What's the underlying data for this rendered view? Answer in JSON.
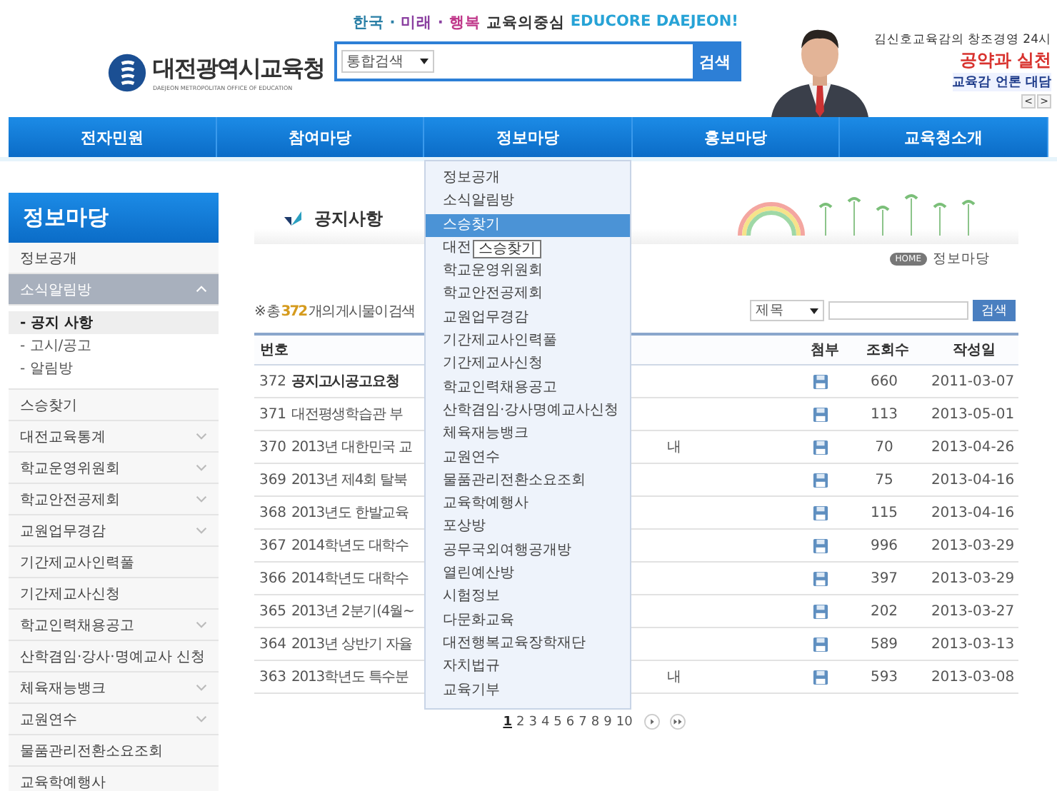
{
  "header": {
    "logo": {
      "title": "대전광역시교육청",
      "subtitle": "DAEJEON METROPOLITAN OFFICE OF EDUCATION"
    },
    "slogan": [
      {
        "text": "한국 ·",
        "color": "#2a7fa6"
      },
      {
        "text": "미래 ·",
        "color": "#8a3fa0"
      },
      {
        "text": "행복",
        "color": "#c0388a"
      },
      {
        "text": "교육의중심",
        "color": "#333333"
      },
      {
        "text": "EDUCORE DAEJEON!",
        "color": "#27a3d6"
      }
    ],
    "search": {
      "scope": "통합검색",
      "button": "검색"
    },
    "promo": {
      "line1": "김신호교육감의 창조경영 24시",
      "line2": "공약과 실천",
      "line3": "교육감 언론 대담",
      "prev": "<",
      "next": ">"
    }
  },
  "nav": [
    "전자민원",
    "참여마당",
    "정보마당",
    "홍보마당",
    "교육청소개"
  ],
  "sidebar": {
    "title": "정보마당",
    "items": [
      {
        "label": "정보공개",
        "kind": "link",
        "selected": false
      },
      {
        "label": "소식알림방",
        "kind": "folder",
        "expanded": true,
        "selected": true,
        "children": [
          {
            "label": "- 공지 사항",
            "selected": true
          },
          {
            "label": "- 고시/공고",
            "selected": false
          },
          {
            "label": "- 알림방",
            "selected": false
          }
        ]
      },
      {
        "label": "스승찾기",
        "kind": "link",
        "selected": false
      },
      {
        "label": "대전교육통계",
        "kind": "folder",
        "expanded": false,
        "selected": false
      },
      {
        "label": "학교운영위원회",
        "kind": "folder",
        "expanded": false,
        "selected": false
      },
      {
        "label": "학교안전공제회",
        "kind": "folder",
        "expanded": false,
        "selected": false
      },
      {
        "label": "교원업무경감",
        "kind": "folder",
        "expanded": false,
        "selected": false
      },
      {
        "label": "기간제교사인력풀",
        "kind": "link",
        "selected": false
      },
      {
        "label": "기간제교사신청",
        "kind": "link",
        "selected": false
      },
      {
        "label": "학교인력채용공고",
        "kind": "folder",
        "expanded": false,
        "selected": false
      },
      {
        "label": "산학겸임·강사·명예교사 신청",
        "kind": "link",
        "selected": false
      },
      {
        "label": "체육재능뱅크",
        "kind": "folder",
        "expanded": false,
        "selected": false
      },
      {
        "label": "교원연수",
        "kind": "folder",
        "expanded": false,
        "selected": false
      },
      {
        "label": "물품관리전환소요조회",
        "kind": "link",
        "selected": false
      },
      {
        "label": "교육학예행사",
        "kind": "link",
        "selected": false
      }
    ]
  },
  "content": {
    "title": "공지사항",
    "breadcrumb": {
      "home": "HOME",
      "current": "정보마당"
    },
    "count": {
      "prefix": "※ 총",
      "number": "372",
      "suffix": "개의 게시물이 검색"
    },
    "search": {
      "field": "제목",
      "button": "검색"
    },
    "table": {
      "columns": [
        "번호",
        "첨부",
        "조회수",
        "작성일"
      ],
      "rows": [
        {
          "no": "372",
          "title": "공지고시공고요청",
          "bold": true,
          "views": "660",
          "date": "2011-03-07"
        },
        {
          "no": "371",
          "title": "대전평생학습관 부",
          "bold": false,
          "views": "113",
          "date": "2013-05-01"
        },
        {
          "no": "370",
          "title": "2013년 대한민국 교",
          "title_end": "내",
          "bold": false,
          "views": "70",
          "date": "2013-04-26"
        },
        {
          "no": "369",
          "title": "2013년 제4회 탈북",
          "bold": false,
          "views": "75",
          "date": "2013-04-16"
        },
        {
          "no": "368",
          "title": "2013년도 한발교육",
          "bold": false,
          "views": "115",
          "date": "2013-04-16"
        },
        {
          "no": "367",
          "title": "2014학년도 대학수",
          "bold": false,
          "views": "996",
          "date": "2013-03-29"
        },
        {
          "no": "366",
          "title": "2014학년도 대학수",
          "bold": false,
          "views": "397",
          "date": "2013-03-29"
        },
        {
          "no": "365",
          "title": "2013년 2분기(4월~",
          "bold": false,
          "views": "202",
          "date": "2013-03-27"
        },
        {
          "no": "364",
          "title": "2013년 상반기 자율",
          "bold": false,
          "views": "589",
          "date": "2013-03-13"
        },
        {
          "no": "363",
          "title": "2013학년도 특수분",
          "title_end": "내",
          "bold": false,
          "views": "593",
          "date": "2013-03-08"
        }
      ]
    },
    "pages": [
      {
        "label": "1",
        "selected": true
      },
      {
        "label": "2",
        "selected": false
      },
      {
        "label": "3",
        "selected": false
      },
      {
        "label": "4",
        "selected": false
      },
      {
        "label": "5",
        "selected": false
      },
      {
        "label": "6",
        "selected": false
      },
      {
        "label": "7",
        "selected": false
      },
      {
        "label": "8",
        "selected": false
      },
      {
        "label": "9",
        "selected": false
      },
      {
        "label": "10",
        "selected": false
      }
    ]
  },
  "dropdown": {
    "items": [
      {
        "label": "정보공개",
        "selected": false
      },
      {
        "label": "소식알림방",
        "selected": false
      },
      {
        "label": "스승찾기",
        "selected": true
      },
      {
        "label": "대전",
        "selected": false
      },
      {
        "label": "학교운영위원회",
        "selected": false
      },
      {
        "label": "학교안전공제회",
        "selected": false
      },
      {
        "label": "교원업무경감",
        "selected": false
      },
      {
        "label": "기간제교사인력풀",
        "selected": false
      },
      {
        "label": "기간제교사신청",
        "selected": false
      },
      {
        "label": "학교인력채용공고",
        "selected": false
      },
      {
        "label": "산학겸임·강사명예교사신청",
        "selected": false
      },
      {
        "label": "체육재능뱅크",
        "selected": false
      },
      {
        "label": "교원연수",
        "selected": false
      },
      {
        "label": "물품관리전환소요조회",
        "selected": false
      },
      {
        "label": "교육학예행사",
        "selected": false
      },
      {
        "label": "포상방",
        "selected": false
      },
      {
        "label": "공무국외여행공개방",
        "selected": false
      },
      {
        "label": "열린예산방",
        "selected": false
      },
      {
        "label": "시험정보",
        "selected": false
      },
      {
        "label": "다문화교육",
        "selected": false
      },
      {
        "label": "대전행복교육장학재단",
        "selected": false
      },
      {
        "label": "자치법규",
        "selected": false
      },
      {
        "label": "교육기부",
        "selected": false
      }
    ],
    "tooltip": "스승찾기"
  }
}
